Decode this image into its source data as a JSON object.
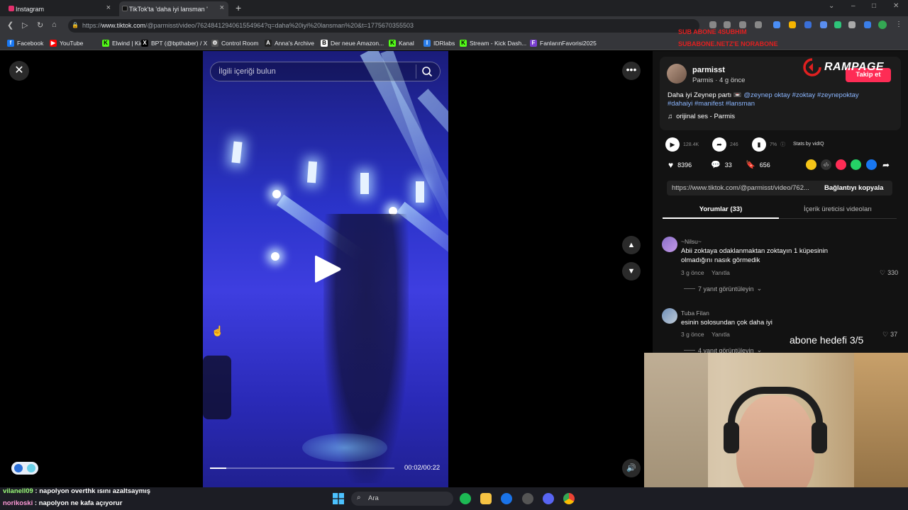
{
  "browser": {
    "tabs": [
      {
        "title": "Instagram",
        "color": "#e1306c"
      },
      {
        "title": "TikTok'ta 'daha iyi lansman '",
        "color": "#111111"
      }
    ],
    "url_prefix": "https://",
    "url_domain": "www.tiktok.com",
    "url_path": "/@parmisst/video/7624841294061554964?q=daha%20iyi%20lansman%20&t=1775670355503",
    "bookmarks": [
      {
        "label": "Facebook",
        "icon": "facebook-icon",
        "color": "#1877f2",
        "glyph": "f"
      },
      {
        "label": "YouTube",
        "icon": "youtube-icon",
        "color": "#ff0000",
        "glyph": "▶"
      },
      {
        "label": "Elwind | Kick",
        "icon": "kick-icon",
        "color": "#53fc18",
        "glyph": "K"
      },
      {
        "label": "BPT (@bpthaber) / X",
        "icon": "x-icon",
        "color": "#000000",
        "glyph": "X"
      },
      {
        "label": "Control Room",
        "icon": "gear-icon",
        "color": "#555555",
        "glyph": "⚙"
      },
      {
        "label": "Anna's Archive",
        "icon": "archive-icon",
        "color": "#222222",
        "glyph": "A"
      },
      {
        "label": "Der neue Amazon...",
        "icon": "book-icon",
        "color": "#ffffff",
        "glyph": "B"
      },
      {
        "label": "Kanal",
        "icon": "kick-icon",
        "color": "#53fc18",
        "glyph": "K"
      },
      {
        "label": "IDRlabs",
        "icon": "idrlabs-icon",
        "color": "#2b7de9",
        "glyph": "I"
      },
      {
        "label": "Stream - Kick Dash...",
        "icon": "kick-icon",
        "color": "#53fc18",
        "glyph": "K"
      },
      {
        "label": "FanlarınFavorisi2025",
        "icon": "star-icon",
        "color": "#7a3fd1",
        "glyph": "F"
      }
    ],
    "overlay_line1": "SUB ABONE 4SUBHIM",
    "overlay_line2": "SUBABONE.NETZ'E NORABONE"
  },
  "video": {
    "search_placeholder": "İlgili içeriği bulun",
    "time": "00:02/00:22",
    "progress": 0.09
  },
  "post": {
    "username": "parmisst",
    "meta": "Parmis · 4 g önce",
    "follow_label": "Takip et",
    "rampage": "RAMPAGE",
    "caption_plain": "Daha iyi Zeynep partı 📼 ",
    "caption_tags_line1": "@zeynep oktay #zoktay #zeynepoktay",
    "caption_tags_line2": "#dahaiyi #manifest #lansman",
    "sound": "orijinal ses - Parmis",
    "vidiq_views": "128.4K",
    "vidiq_shares": "246",
    "vidiq_engagement": "7%",
    "stats_by": "Stats by vidIQ",
    "likes": "8396",
    "comments": "33",
    "saves": "656",
    "link": "https://www.tiktok.com/@parmisst/video/762...",
    "copy_label": "Bağlantıyı kopyala",
    "tab_comments": "Yorumlar (33)",
    "tab_creator": "İçerik üreticisi videoları"
  },
  "comments": [
    {
      "user": "~Nilsu~",
      "text_line1": "Abii zoktaya odaklanmaktan zoktayın 1 küpesinin",
      "text_line2": "olmadığını nasık görmedik",
      "time": "3 g önce",
      "reply": "Yanıtla",
      "likes": "330",
      "replies": "7 yanıt görüntüleyin"
    },
    {
      "user": "Tuba Filan",
      "text_line1": "esinin solosundan çok daha iyi",
      "text_line2": "",
      "time": "3 g önce",
      "reply": "Yanıtla",
      "likes": "37",
      "replies": "4 yanıt görüntüleyin"
    }
  ],
  "stream": {
    "abone_hedef": "abone hedefi 3/5",
    "chat": [
      {
        "user": "vilanell09",
        "sep": " : ",
        "msg": "napolyon overthk ısını azaltsaymış"
      },
      {
        "user": "norikoski",
        "sep": " : ",
        "msg": "napolyon ne kafa açıyorur"
      }
    ]
  },
  "taskbar": {
    "search_label": "Ara"
  }
}
